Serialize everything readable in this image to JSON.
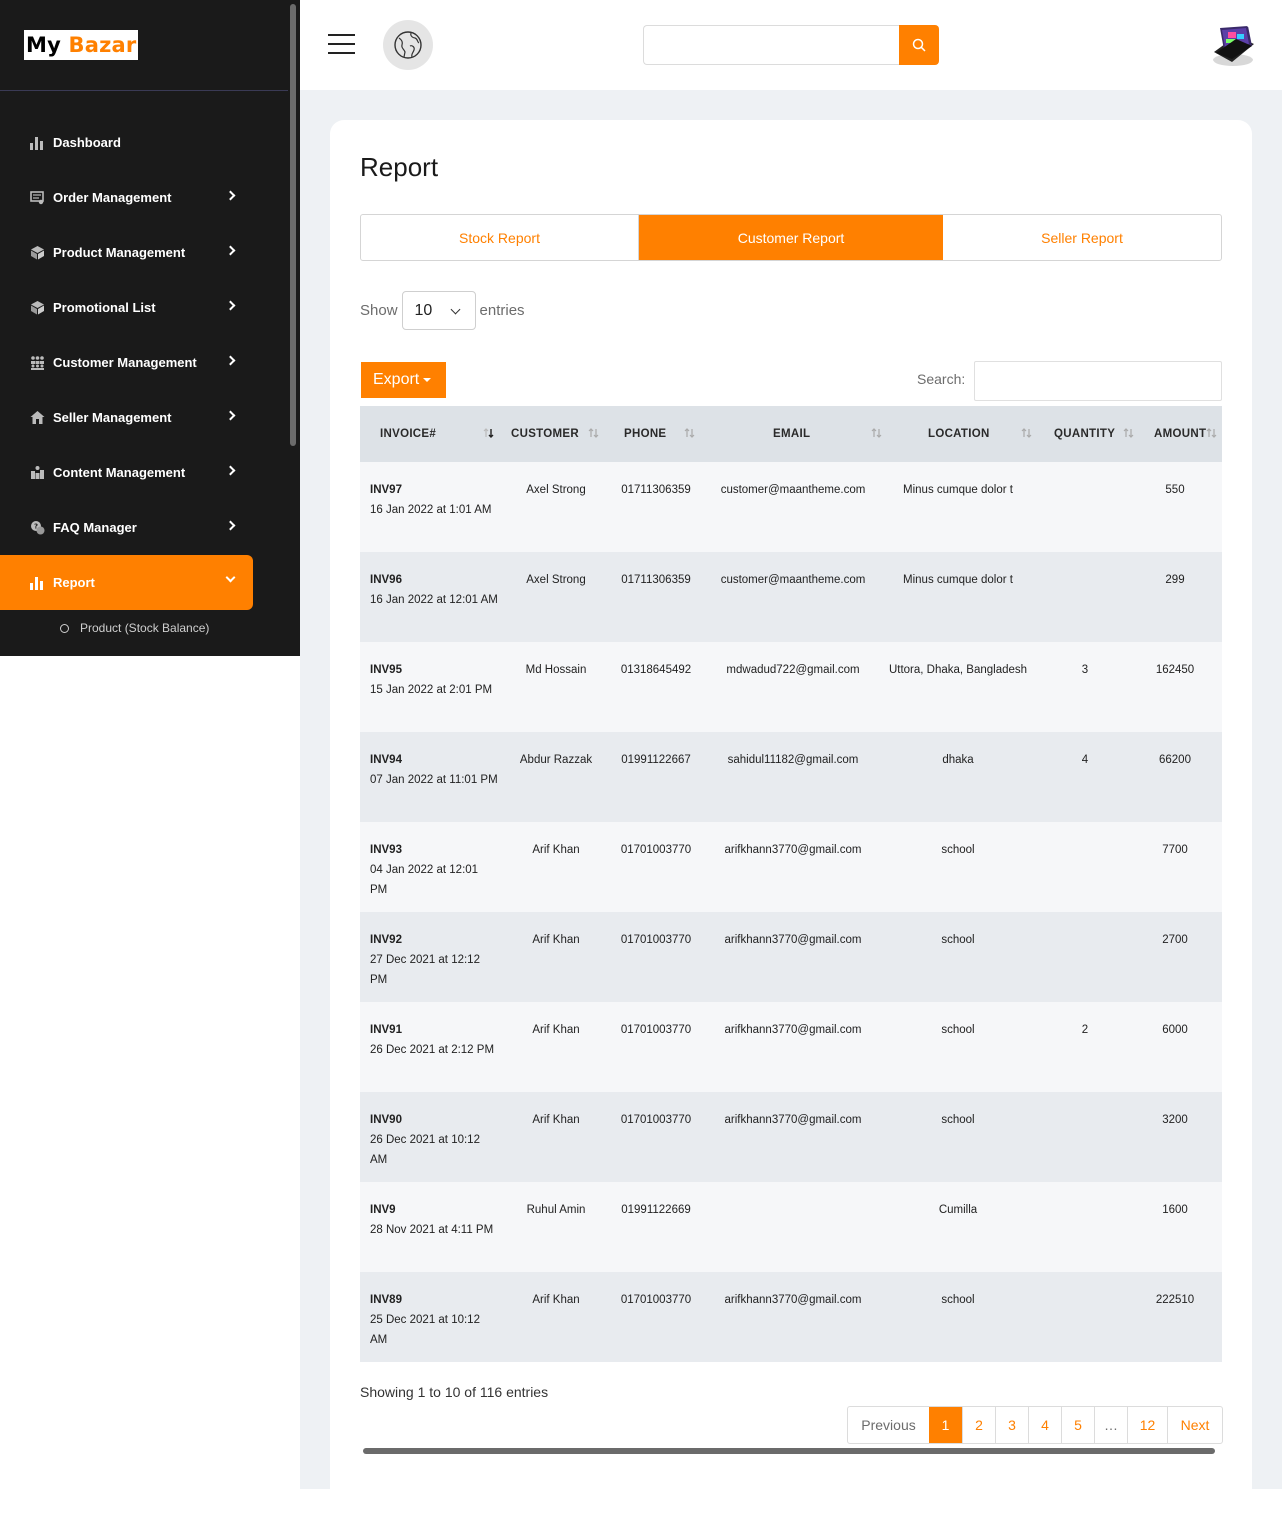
{
  "brand": {
    "part1": "My ",
    "part2": "Bazar"
  },
  "sidebar": {
    "items": [
      {
        "label": "Dashboard",
        "icon": "bar-chart-icon"
      },
      {
        "label": "Order Management",
        "icon": "orders-icon"
      },
      {
        "label": "Product Management",
        "icon": "box-icon"
      },
      {
        "label": "Promotional List",
        "icon": "box-icon"
      },
      {
        "label": "Customer Management",
        "icon": "users-icon"
      },
      {
        "label": "Seller Management",
        "icon": "store-icon"
      },
      {
        "label": "Content Management",
        "icon": "content-icon"
      },
      {
        "label": "FAQ Manager",
        "icon": "faq-icon"
      },
      {
        "label": "Report",
        "icon": "bar-chart-icon",
        "active": true
      }
    ],
    "sub_items": [
      {
        "label": "Product (Stock Balance)"
      }
    ]
  },
  "topbar": {
    "search_placeholder": ""
  },
  "page": {
    "title": "Report",
    "tabs": [
      {
        "label": "Stock Report"
      },
      {
        "label": "Customer Report",
        "active": true
      },
      {
        "label": "Seller Report"
      }
    ],
    "show_label": "Show",
    "entries_label": "entries",
    "length_value": "10",
    "export_label": "Export",
    "search_label": "Search:"
  },
  "table": {
    "columns": [
      "INVOICE#",
      "CUSTOMER",
      "PHONE",
      "EMAIL",
      "LOCATION",
      "QUANTITY",
      "AMOUNT"
    ],
    "rows": [
      {
        "inv": "INV97",
        "date": "16 Jan 2022 at 1:01 AM",
        "customer": "Axel Strong",
        "phone": "01711306359",
        "email": "customer@maantheme.com",
        "location": "Minus cumque dolor t",
        "qty": "",
        "amount": "550"
      },
      {
        "inv": "INV96",
        "date": "16 Jan 2022 at 12:01 AM",
        "customer": "Axel Strong",
        "phone": "01711306359",
        "email": "customer@maantheme.com",
        "location": "Minus cumque dolor t",
        "qty": "",
        "amount": "299"
      },
      {
        "inv": "INV95",
        "date": "15 Jan 2022 at 2:01 PM",
        "customer": "Md Hossain",
        "phone": "01318645492",
        "email": "mdwadud722@gmail.com",
        "location": "Uttora, Dhaka, Bangladesh",
        "qty": "3",
        "amount": "162450"
      },
      {
        "inv": "INV94",
        "date": "07 Jan 2022 at 11:01 PM",
        "customer": "Abdur Razzak",
        "phone": "01991122667",
        "email": "sahidul11182@gmail.com",
        "location": "dhaka",
        "qty": "4",
        "amount": "66200"
      },
      {
        "inv": "INV93",
        "date": "04 Jan 2022 at 12:01 PM",
        "customer": "Arif Khan",
        "phone": "01701003770",
        "email": "arifkhann3770@gmail.com",
        "location": "school",
        "qty": "",
        "amount": "7700"
      },
      {
        "inv": "INV92",
        "date": "27 Dec 2021 at 12:12 PM",
        "customer": "Arif Khan",
        "phone": "01701003770",
        "email": "arifkhann3770@gmail.com",
        "location": "school",
        "qty": "",
        "amount": "2700"
      },
      {
        "inv": "INV91",
        "date": "26 Dec 2021 at 2:12 PM",
        "customer": "Arif Khan",
        "phone": "01701003770",
        "email": "arifkhann3770@gmail.com",
        "location": "school",
        "qty": "2",
        "amount": "6000"
      },
      {
        "inv": "INV90",
        "date": "26 Dec 2021 at 10:12 AM",
        "customer": "Arif Khan",
        "phone": "01701003770",
        "email": "arifkhann3770@gmail.com",
        "location": "school",
        "qty": "",
        "amount": "3200"
      },
      {
        "inv": "INV9",
        "date": "28 Nov 2021 at 4:11 PM",
        "customer": "Ruhul Amin",
        "phone": "01991122669",
        "email": "",
        "location": "Cumilla",
        "qty": "",
        "amount": "1600"
      },
      {
        "inv": "INV89",
        "date": "25 Dec 2021 at 10:12 AM",
        "customer": "Arif Khan",
        "phone": "01701003770",
        "email": "arifkhann3770@gmail.com",
        "location": "school",
        "qty": "",
        "amount": "222510"
      }
    ]
  },
  "footer": {
    "info": "Showing 1 to 10 of 116 entries",
    "pagination": {
      "previous": "Previous",
      "pages": [
        "1",
        "2",
        "3",
        "4",
        "5",
        "…",
        "12"
      ],
      "next": "Next",
      "current": "1"
    }
  },
  "colors": {
    "accent": "#ff8000",
    "sidebar_bg": "#1a1a1a",
    "page_bg": "#eef1f4"
  }
}
